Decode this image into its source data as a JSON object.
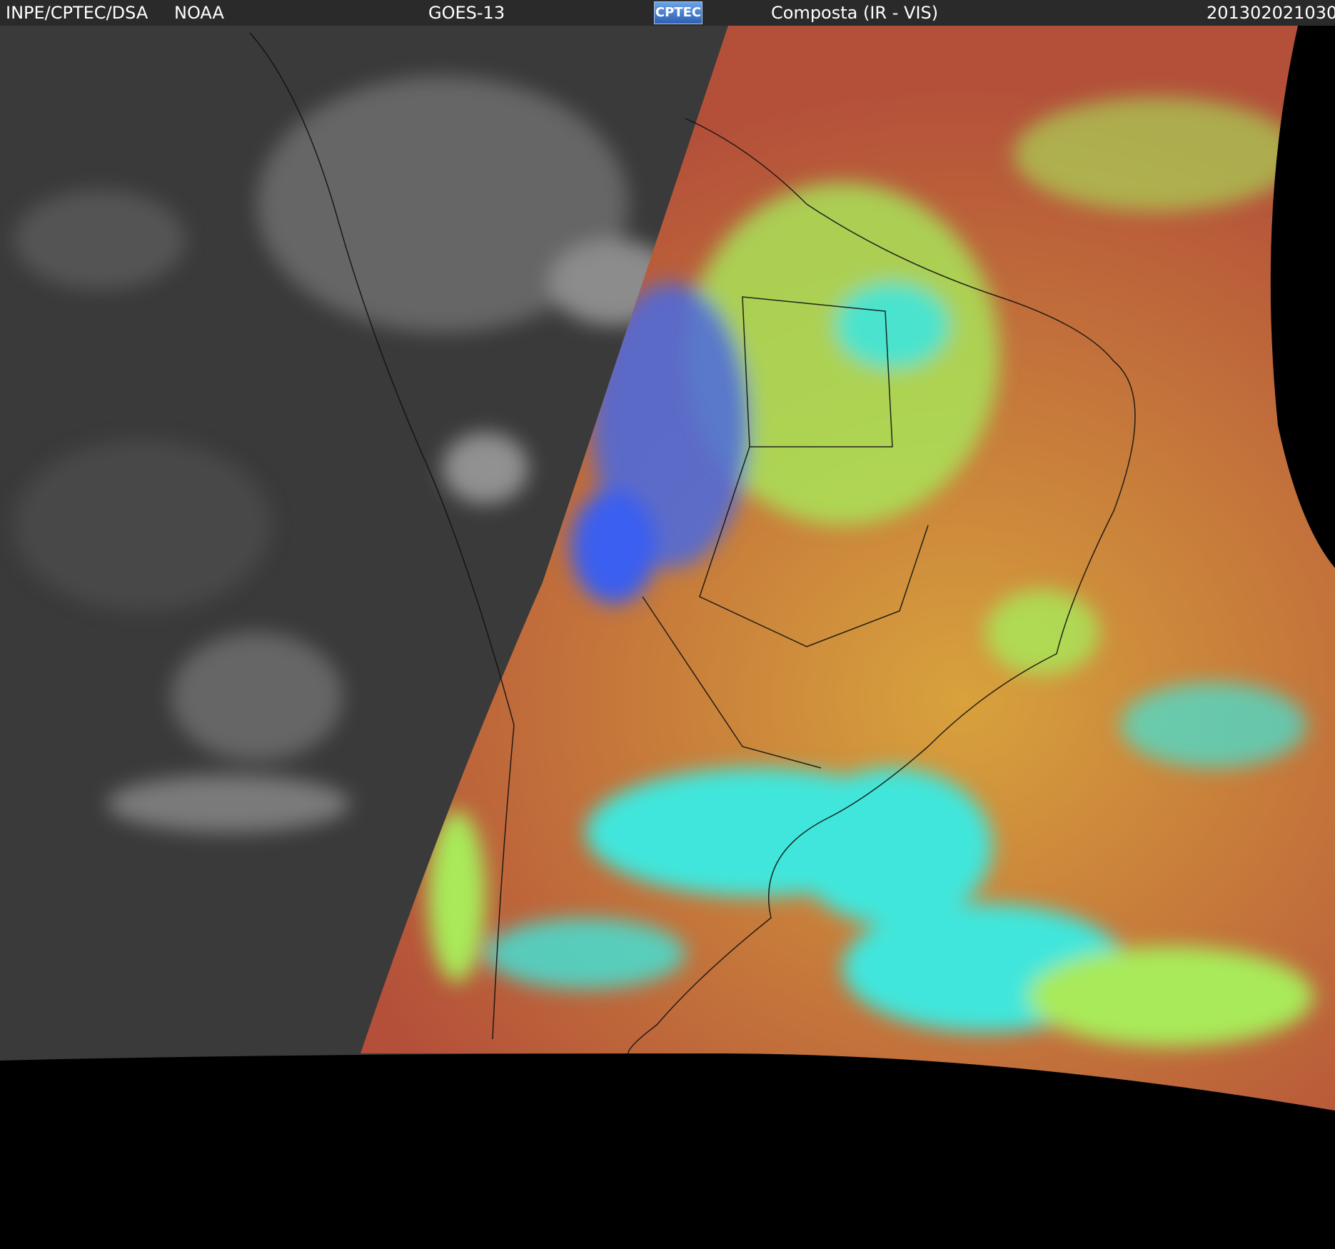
{
  "header": {
    "source": "INPE/CPTEC/DSA",
    "agency": "NOAA",
    "satellite": "GOES-13",
    "logo_text": "CPTEC",
    "product": "Composta (IR - VIS)",
    "timestamp": "201302021030"
  },
  "image": {
    "description_icon": "satellite-composite-image",
    "palette": {
      "night_ir": "#3a3a3a",
      "ocean_red": "#b4503a",
      "cloud_cyan": "#3fe6dc",
      "cloud_green": "#a8ea5a",
      "land_blue": "#4a6ae0",
      "space": "#000000"
    }
  }
}
